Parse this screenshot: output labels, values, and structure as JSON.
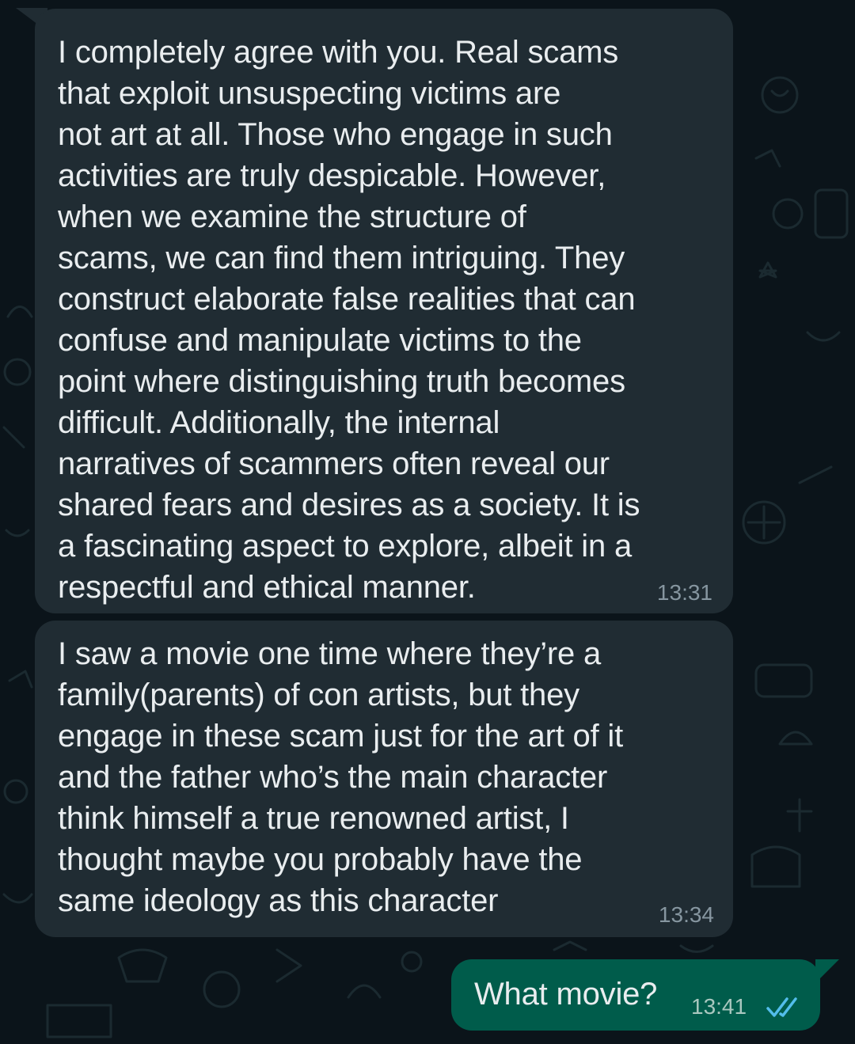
{
  "chat": {
    "messages": [
      {
        "direction": "incoming",
        "text": "I completely agree with you. Real scams\nthat exploit unsuspecting victims are\nnot art at all. Those who engage in such\nactivities are truly despicable. However,\nwhen we examine the structure of\nscams, we can find them intriguing. They\nconstruct elaborate false realities that can\nconfuse and manipulate victims to the\npoint where distinguishing truth becomes\ndifficult. Additionally, the internal\nnarratives of scammers often reveal our\nshared fears and desires as a society. It is\na fascinating aspect to explore, albeit in a\nrespectful and ethical manner.",
        "time": "13:31"
      },
      {
        "direction": "incoming",
        "text": "I saw a movie one time where they’re a\nfamily(parents) of con artists, but they\nengage in these scam just for the art of it\nand the father who’s the main character\nthink himself a true renowned artist, I\nthought maybe you probably have the\nsame ideology as this character",
        "time": "13:34"
      },
      {
        "direction": "outgoing",
        "text": "What movie?",
        "time": "13:41",
        "status": "read"
      }
    ]
  },
  "colors": {
    "background": "#0b141a",
    "incoming_bubble": "#202c33",
    "outgoing_bubble": "#005c4b",
    "text": "#e9edef",
    "timestamp": "#8696a0",
    "read_ticks": "#53bdeb"
  },
  "icons": {
    "read_receipt": "double-check-icon"
  }
}
